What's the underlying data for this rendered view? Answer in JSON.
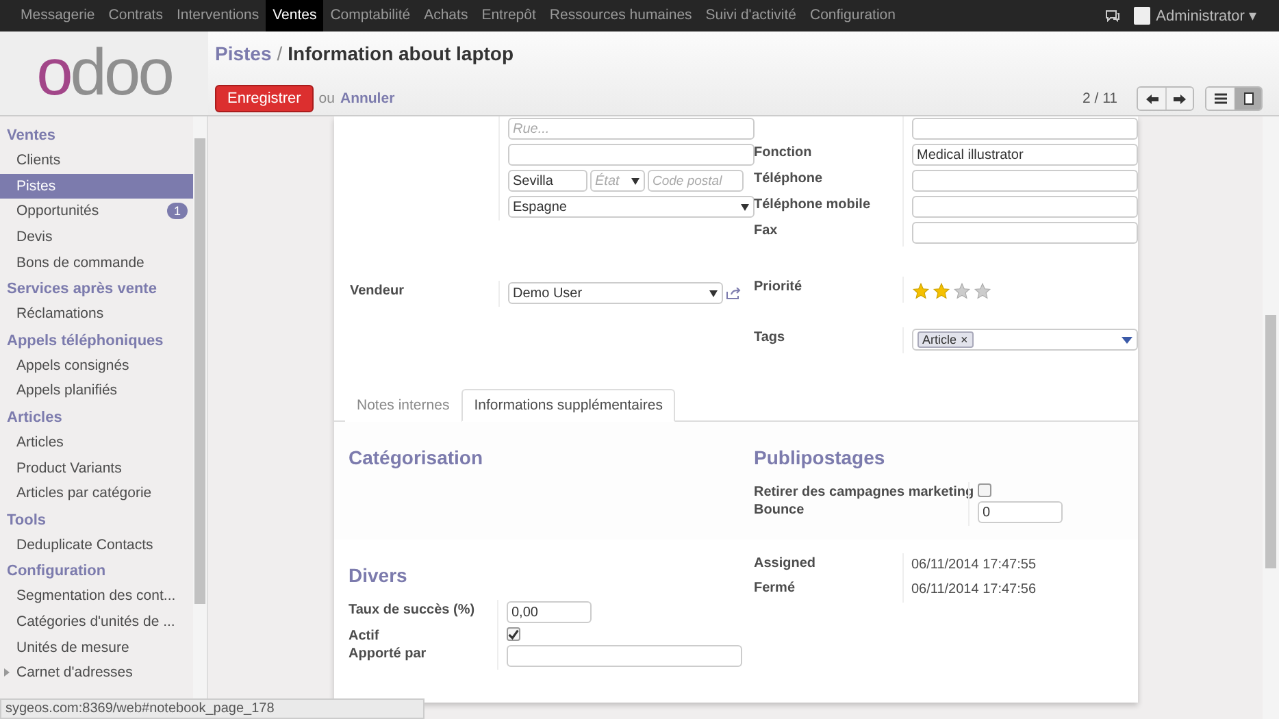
{
  "topnav": {
    "menus": [
      {
        "label": "Messagerie",
        "selected": false
      },
      {
        "label": "Contrats",
        "selected": false
      },
      {
        "label": "Interventions",
        "selected": false
      },
      {
        "label": "Ventes",
        "selected": true
      },
      {
        "label": "Comptabilité",
        "selected": false
      },
      {
        "label": "Achats",
        "selected": false
      },
      {
        "label": "Entrepôt",
        "selected": false
      },
      {
        "label": "Ressources humaines",
        "selected": false
      },
      {
        "label": "Suivi d'activité",
        "selected": false
      },
      {
        "label": "Configuration",
        "selected": false
      }
    ],
    "user": "Administrator",
    "user_caret": "▾"
  },
  "logo": {
    "text": "odoo"
  },
  "sidebar": {
    "sections": [
      {
        "title": "Ventes",
        "items": [
          {
            "label": "Clients",
            "selected": false
          },
          {
            "label": "Pistes",
            "selected": true
          },
          {
            "label": "Opportunités",
            "selected": false,
            "badge": "1"
          },
          {
            "label": "Devis",
            "selected": false
          },
          {
            "label": "Bons de commande",
            "selected": false
          }
        ]
      },
      {
        "title": "Services après vente",
        "items": [
          {
            "label": "Réclamations",
            "selected": false
          }
        ]
      },
      {
        "title": "Appels téléphoniques",
        "items": [
          {
            "label": "Appels consignés",
            "selected": false
          },
          {
            "label": "Appels planifiés",
            "selected": false
          }
        ]
      },
      {
        "title": "Articles",
        "items": [
          {
            "label": "Articles",
            "selected": false
          },
          {
            "label": "Product Variants",
            "selected": false
          },
          {
            "label": "Articles par catégorie",
            "selected": false
          }
        ]
      },
      {
        "title": "Tools",
        "items": [
          {
            "label": "Deduplicate Contacts",
            "selected": false
          }
        ]
      },
      {
        "title": "Configuration",
        "items": [
          {
            "label": "Segmentation des cont...",
            "selected": false
          },
          {
            "label": "Catégories d'unités de ...",
            "selected": false
          },
          {
            "label": "Unités de mesure",
            "selected": false
          },
          {
            "label": "Carnet d'adresses",
            "selected": false,
            "expanded": false
          }
        ]
      }
    ]
  },
  "breadcrumb": {
    "parent": "Pistes",
    "separator": "/",
    "current": "Information about laptop"
  },
  "actions": {
    "save": "Enregistrer",
    "or": "ou",
    "cancel": "Annuler"
  },
  "pager": "2 / 11",
  "views": [
    {
      "kind": "list",
      "selected": false
    },
    {
      "kind": "form",
      "selected": true
    }
  ],
  "form": {
    "address": {
      "street": {
        "placeholder": "Rue..."
      },
      "city": {
        "value": "Sevilla"
      },
      "state": {
        "placeholder": "État"
      },
      "zip": {
        "placeholder": "Code postal"
      },
      "country": {
        "value": "Espagne"
      }
    },
    "salesperson": {
      "label": "Vendeur",
      "value": "Demo User"
    },
    "contact_fields": [
      {
        "kind": "input"
      },
      {
        "kind": "input",
        "label": "Fonction",
        "value": "Medical illustrator"
      },
      {
        "kind": "input",
        "label": "Téléphone"
      },
      {
        "kind": "input",
        "label": "Téléphone mobile"
      },
      {
        "kind": "input",
        "label": "Fax"
      }
    ],
    "priority": {
      "label": "Priorité",
      "stars": 2
    },
    "tags": {
      "label": "Tags",
      "items": [
        {
          "label": "Article",
          "remove": "×"
        }
      ]
    }
  },
  "tabs": [
    {
      "label": "Notes internes",
      "selected": false
    },
    {
      "label": "Informations supplémentaires",
      "selected": true
    }
  ],
  "sections": {
    "categorisation": {
      "title": "Catégorisation"
    },
    "mailing": {
      "title": "Publipostages",
      "fields": [
        {
          "kind": "checkbox",
          "label": "Retirer des campagnes marketing",
          "checked": false
        },
        {
          "kind": "input",
          "label": "Bounce",
          "value": "0"
        }
      ]
    },
    "misc": {
      "title": "Divers",
      "fields": [
        {
          "kind": "input",
          "label": "Taux de succès (%)",
          "value": "0,00"
        },
        {
          "kind": "checkbox",
          "label": "Actif",
          "checked": true
        },
        {
          "kind": "input",
          "label": "Apporté par"
        }
      ]
    },
    "dates": [
      {
        "label": "Assigned",
        "value": "06/11/2014 17:47:55"
      },
      {
        "label": "Fermé",
        "value": "06/11/2014 17:47:56"
      }
    ]
  },
  "status_url": "sygeos.com:8369/web#notebook_page_178"
}
